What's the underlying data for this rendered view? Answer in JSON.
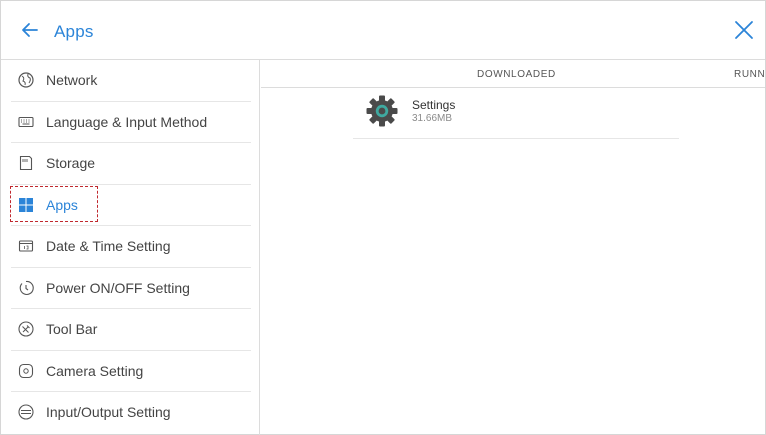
{
  "header": {
    "title": "Apps",
    "back_icon": "arrow-left-icon",
    "close_icon": "close-icon"
  },
  "sidebar": {
    "items": [
      {
        "label": "Network",
        "icon": "globe-icon"
      },
      {
        "label": "Language & Input Method",
        "icon": "keyboard-icon"
      },
      {
        "label": "Storage",
        "icon": "storage-icon"
      },
      {
        "label": "Apps",
        "icon": "apps-grid-icon",
        "active": true
      },
      {
        "label": "Date & Time Setting",
        "icon": "calendar-icon"
      },
      {
        "label": "Power ON/OFF Setting",
        "icon": "power-timer-icon"
      },
      {
        "label": "Tool Bar",
        "icon": "toolbar-icon"
      },
      {
        "label": "Camera Setting",
        "icon": "camera-icon"
      },
      {
        "label": "Input/Output Setting",
        "icon": "input-output-icon"
      }
    ]
  },
  "tabs": [
    {
      "label": "DOWNLOADED"
    },
    {
      "label": "RUNNING"
    }
  ],
  "apps": [
    {
      "name": "Settings",
      "size": "31.66MB",
      "icon": "gear-icon"
    }
  ],
  "colors": {
    "accent": "#2b84d8",
    "highlight_border": "#c0282e",
    "text": "#444444",
    "divider": "#dcdcdc"
  }
}
